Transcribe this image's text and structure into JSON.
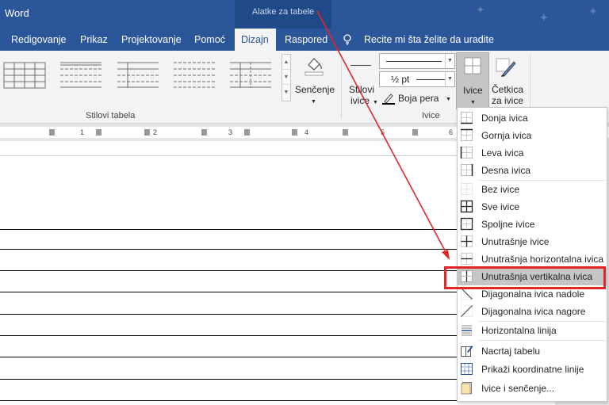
{
  "app": {
    "name": "Word",
    "context_group": "Alatke za tabele"
  },
  "tabs": [
    "Redigovanje",
    "Prikaz",
    "Projektovanje",
    "Pomoć",
    "Dizajn",
    "Raspored"
  ],
  "active_tab": "Dizajn",
  "tell_me": "Recite mi šta želite da uradite",
  "ribbon": {
    "shading_label": "Senčenje",
    "table_styles_label": "Stilovi tabela",
    "border_styles_line1": "Stilovi",
    "border_styles_line2": "ivice",
    "line_weight": "½ pt",
    "pen_color": "Boja pera",
    "borders_button": "Ivice",
    "border_painter_line1": "Četkica",
    "border_painter_line2": "za ivice",
    "borders_group_label": "Ivice"
  },
  "ruler": {
    "marks": [
      "1",
      "2",
      "3",
      "4",
      "5",
      "6"
    ]
  },
  "borders_menu": {
    "items": [
      {
        "label": "Donja ivica",
        "icon": "border-bottom-icon"
      },
      {
        "label": "Gornja ivica",
        "icon": "border-top-icon"
      },
      {
        "label": "Leva ivica",
        "icon": "border-left-icon"
      },
      {
        "label": "Desna ivica",
        "icon": "border-right-icon"
      },
      {
        "label": "Bez ivice",
        "icon": "no-border-icon"
      },
      {
        "label": "Sve ivice",
        "icon": "all-borders-icon"
      },
      {
        "label": "Spoljne ivice",
        "icon": "outside-borders-icon"
      },
      {
        "label": "Unutrašnje ivice",
        "icon": "inside-borders-icon"
      },
      {
        "label": "Unutrašnja horizontalna ivica",
        "icon": "inside-horizontal-border-icon"
      },
      {
        "label": "Unutrašnja vertikalna ivica",
        "icon": "inside-vertical-border-icon"
      },
      {
        "label": "Dijagonalna ivica nadole",
        "icon": "diagonal-down-border-icon"
      },
      {
        "label": "Dijagonalna ivica nagore",
        "icon": "diagonal-up-border-icon"
      },
      {
        "label": "Horizontalna linija",
        "icon": "horizontal-line-icon"
      },
      {
        "label": "Nacrtaj tabelu",
        "icon": "draw-table-icon"
      },
      {
        "label": "Prikaži koordinatne linije",
        "icon": "view-gridlines-icon"
      },
      {
        "label": "Ivice i senčenje...",
        "icon": "borders-shading-dialog-icon"
      }
    ],
    "highlighted_item": "Unutrašnja vertikalna ivica"
  },
  "colors": {
    "title_bar": "#2b579a",
    "highlight_box": "#e32526",
    "arrow": "#e32526"
  }
}
